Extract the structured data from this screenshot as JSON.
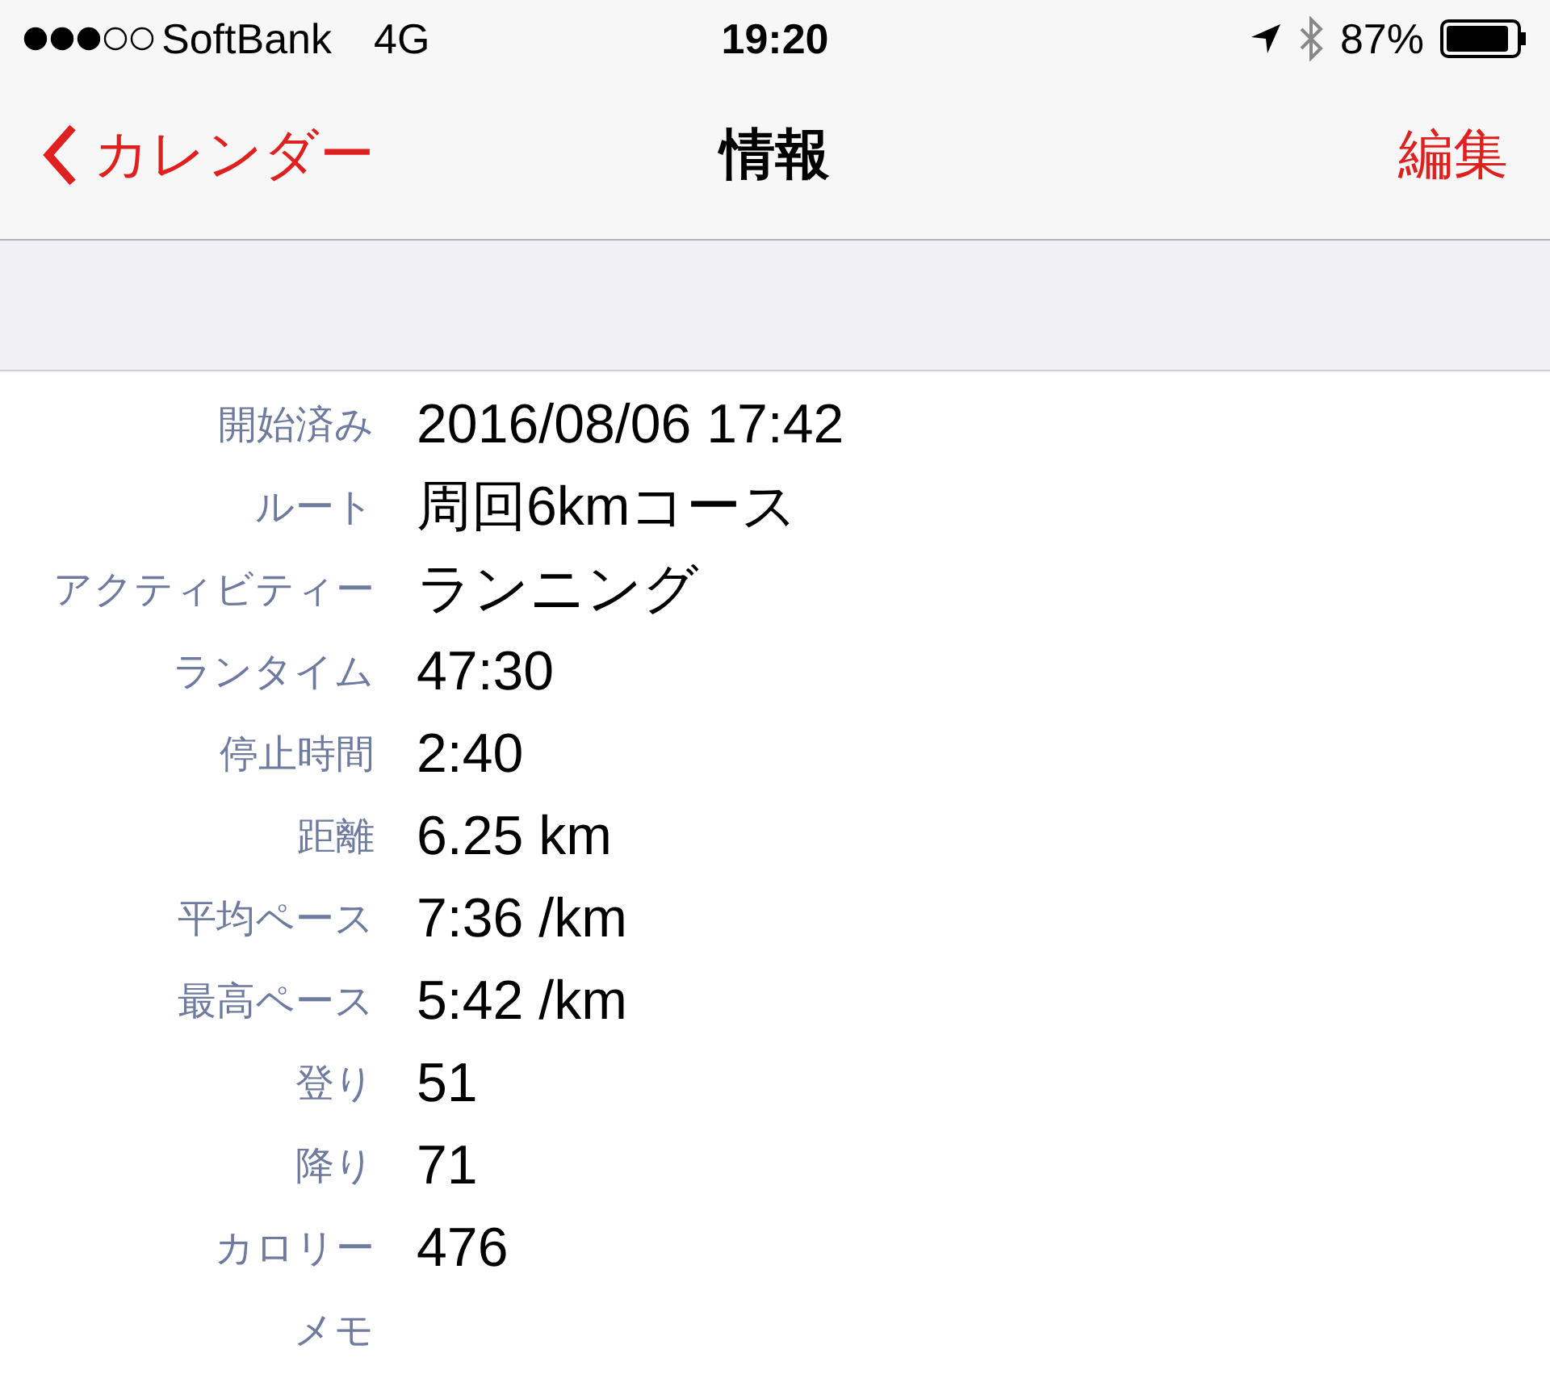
{
  "status_bar": {
    "carrier": "SoftBank",
    "network": "4G",
    "time": "19:20",
    "battery": "87%"
  },
  "nav_bar": {
    "back": "カレンダー",
    "title": "情報",
    "action": "編集"
  },
  "rows": [
    {
      "label": "開始済み",
      "value": "2016/08/06 17:42"
    },
    {
      "label": "ルート",
      "value": "周回6kmコース"
    },
    {
      "label": "アクティビティー",
      "value": "ランニング"
    },
    {
      "label": "ランタイム",
      "value": "47:30"
    },
    {
      "label": "停止時間",
      "value": "2:40"
    },
    {
      "label": "距離",
      "value": "6.25 km"
    },
    {
      "label": "平均ペース",
      "value": "7:36 /km"
    },
    {
      "label": "最高ペース",
      "value": "5:42 /km"
    },
    {
      "label": "登り",
      "value": "51"
    },
    {
      "label": "降り",
      "value": "71"
    },
    {
      "label": "カロリー",
      "value": "476"
    },
    {
      "label": "メモ"
    }
  ]
}
